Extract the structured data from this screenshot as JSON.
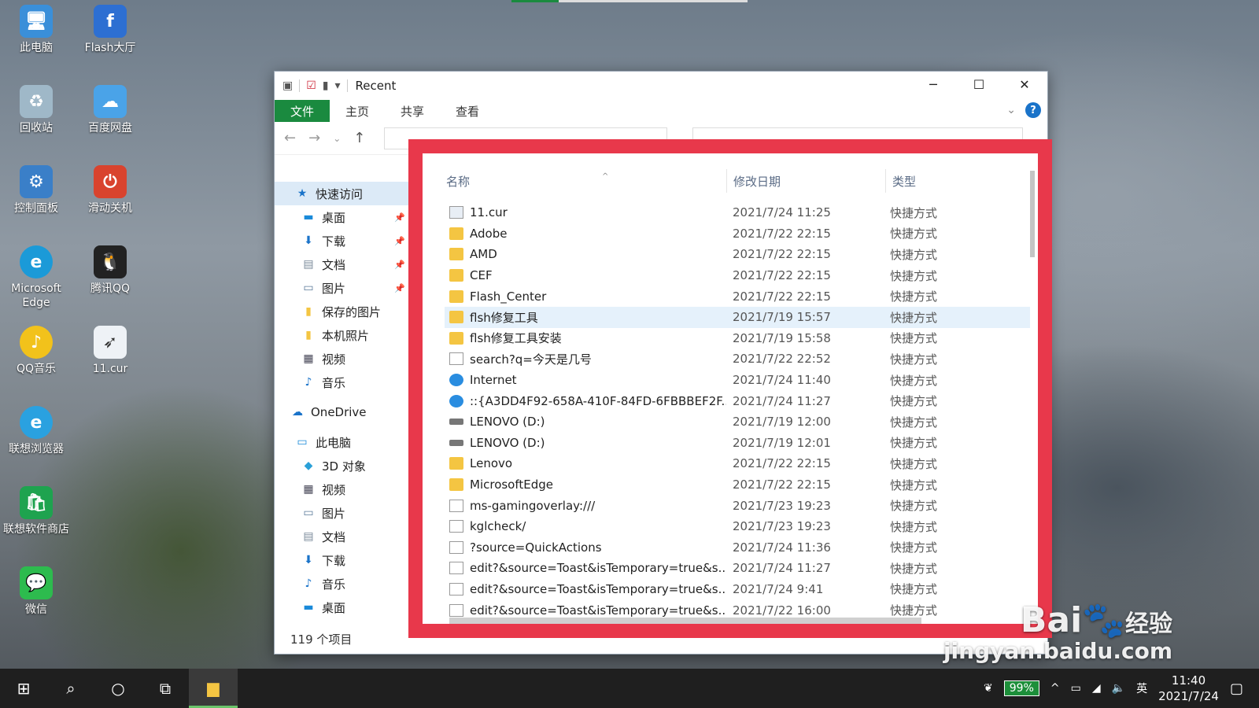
{
  "desktop": {
    "icons": [
      {
        "label": "此电脑",
        "glyph": "🖥"
      },
      {
        "label": "Flash大厅",
        "glyph": "f"
      },
      {
        "label": "回收站",
        "glyph": "♻"
      },
      {
        "label": "百度网盘",
        "glyph": "☁"
      },
      {
        "label": "控制面板",
        "glyph": "⚙"
      },
      {
        "label": "滑动关机",
        "glyph": "⏻"
      },
      {
        "label": "Microsoft Edge",
        "glyph": "e"
      },
      {
        "label": "腾讯QQ",
        "glyph": "🐧"
      },
      {
        "label": "QQ音乐",
        "glyph": "♪"
      },
      {
        "label": "11.cur",
        "glyph": "➶"
      },
      {
        "label": "联想浏览器",
        "glyph": "e"
      },
      {
        "label": "联想软件商店",
        "glyph": "🛍"
      },
      {
        "label": "微信",
        "glyph": "💬"
      }
    ],
    "colors": {
      "highlight": "#e8384b",
      "ribbon_file": "#1a8a3f"
    }
  },
  "window": {
    "title": "Recent",
    "ribbon_tabs": {
      "file": "文件",
      "home": "主页",
      "share": "共享",
      "view": "查看"
    },
    "help": "?",
    "nav": {
      "quick_access": "快速访问",
      "qa_items": [
        "桌面",
        "下载",
        "文档",
        "图片",
        "保存的图片",
        "本机照片",
        "视频",
        "音乐"
      ],
      "onedrive": "OneDrive",
      "this_pc": "此电脑",
      "pc_items": [
        "3D 对象",
        "视频",
        "图片",
        "文档",
        "下载",
        "音乐",
        "桌面"
      ]
    },
    "status": "119 个项目",
    "columns": {
      "name": "名称",
      "date": "修改日期",
      "type": "类型"
    },
    "files": [
      {
        "name": "11.cur",
        "date": "2021/7/24 11:25",
        "type": "快捷方式",
        "icon": "cur"
      },
      {
        "name": "Adobe",
        "date": "2021/7/22 22:15",
        "type": "快捷方式",
        "icon": "folder"
      },
      {
        "name": "AMD",
        "date": "2021/7/22 22:15",
        "type": "快捷方式",
        "icon": "folder"
      },
      {
        "name": "CEF",
        "date": "2021/7/22 22:15",
        "type": "快捷方式",
        "icon": "folder"
      },
      {
        "name": "Flash_Center",
        "date": "2021/7/22 22:15",
        "type": "快捷方式",
        "icon": "folder"
      },
      {
        "name": "flsh修复工具",
        "date": "2021/7/19 15:57",
        "type": "快捷方式",
        "icon": "folder",
        "selected": true
      },
      {
        "name": "flsh修复工具安装",
        "date": "2021/7/19 15:58",
        "type": "快捷方式",
        "icon": "folder"
      },
      {
        "name": "search?q=今天是几号",
        "date": "2021/7/22 22:52",
        "type": "快捷方式",
        "icon": "file"
      },
      {
        "name": "Internet",
        "date": "2021/7/24 11:40",
        "type": "快捷方式",
        "icon": "ie"
      },
      {
        "name": "::{A3DD4F92-658A-410F-84FD-6FBBBEF2F...",
        "date": "2021/7/24 11:27",
        "type": "快捷方式",
        "icon": "ie"
      },
      {
        "name": "LENOVO (D:)",
        "date": "2021/7/19 12:00",
        "type": "快捷方式",
        "icon": "drive"
      },
      {
        "name": "LENOVO (D:)",
        "date": "2021/7/19 12:01",
        "type": "快捷方式",
        "icon": "drive"
      },
      {
        "name": "Lenovo",
        "date": "2021/7/22 22:15",
        "type": "快捷方式",
        "icon": "folder"
      },
      {
        "name": "MicrosoftEdge",
        "date": "2021/7/22 22:15",
        "type": "快捷方式",
        "icon": "folder"
      },
      {
        "name": "ms-gamingoverlay:///",
        "date": "2021/7/23 19:23",
        "type": "快捷方式",
        "icon": "file"
      },
      {
        "name": "kglcheck/",
        "date": "2021/7/23 19:23",
        "type": "快捷方式",
        "icon": "file"
      },
      {
        "name": "?source=QuickActions",
        "date": "2021/7/24 11:36",
        "type": "快捷方式",
        "icon": "file"
      },
      {
        "name": "edit?&source=Toast&isTemporary=true&s...",
        "date": "2021/7/24 11:27",
        "type": "快捷方式",
        "icon": "file"
      },
      {
        "name": "edit?&source=Toast&isTemporary=true&s...",
        "date": "2021/7/24 9:41",
        "type": "快捷方式",
        "icon": "file"
      },
      {
        "name": "edit?&source=Toast&isTemporary=true&s...",
        "date": "2021/7/22 16:00",
        "type": "快捷方式",
        "icon": "file"
      }
    ]
  },
  "taskbar": {
    "battery": "99%",
    "ime": "英",
    "time": "11:40",
    "date": "2021/7/24"
  },
  "watermark": {
    "brand": "Bai",
    "brand2": "经验",
    "site": "jingyan.baidu.com"
  }
}
